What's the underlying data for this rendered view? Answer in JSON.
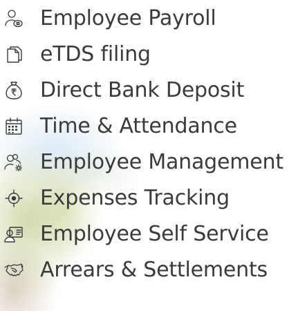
{
  "menu": {
    "items": [
      {
        "label": "Employee Payroll",
        "icon": "user-coin-icon"
      },
      {
        "label": "eTDS filing",
        "icon": "document-icon"
      },
      {
        "label": "Direct Bank Deposit",
        "icon": "money-bag-icon"
      },
      {
        "label": "Time & Attendance",
        "icon": "calendar-icon"
      },
      {
        "label": "Employee Management",
        "icon": "users-gear-icon"
      },
      {
        "label": "Expenses Tracking",
        "icon": "target-icon"
      },
      {
        "label": "Employee Self Service",
        "icon": "id-card-icon"
      },
      {
        "label": "Arrears & Settlements",
        "icon": "handshake-icon"
      }
    ]
  },
  "colors": {
    "text": "#3a3a3a",
    "icon": "#3a3a3a"
  }
}
